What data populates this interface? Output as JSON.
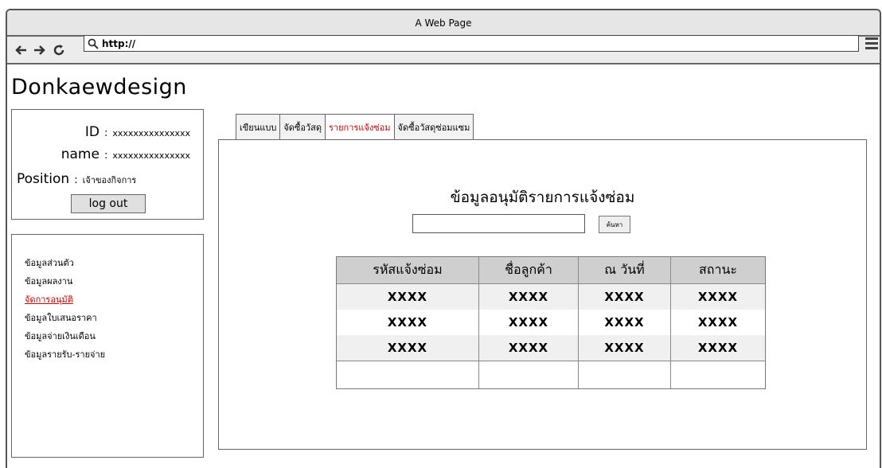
{
  "window": {
    "title": "A Web Page"
  },
  "browser": {
    "url": "http://"
  },
  "brand": "Donkaewdesign",
  "profile": {
    "id_label": "ID",
    "id_value": "xxxxxxxxxxxxxxx",
    "name_label": "name",
    "name_value": "xxxxxxxxxxxxxxx",
    "position_label": "Position",
    "position_value": "เจ้าของกิจการ",
    "separator": ":",
    "logout_label": "log out"
  },
  "sidebar": {
    "items": [
      {
        "label": "ข้อมูลส่วนตัว",
        "active": false
      },
      {
        "label": "ข้อมูลผลงาน",
        "active": false
      },
      {
        "label": "จัดการอนุมัติ",
        "active": true
      },
      {
        "label": "ข้อมูลใบเสนอราคา",
        "active": false
      },
      {
        "label": "ข้อมูลจ่ายเงินเดือน",
        "active": false
      },
      {
        "label": "ข้อมูลรายรับ-รายจ่าย",
        "active": false
      }
    ]
  },
  "tabs": [
    {
      "label": "เขียนแบบ",
      "active": false
    },
    {
      "label": "จัดซื้อวัสดุ",
      "active": false
    },
    {
      "label": "รายการแจ้งซ่อม",
      "active": true
    },
    {
      "label": "จัดซื้อวัสดุซ่อมแซม",
      "active": false
    }
  ],
  "main": {
    "title": "ข้อมูลอนุมัติรายการแจ้งซ่อม",
    "search_button": "ค้นหา",
    "search_value": "",
    "table": {
      "headers": [
        "รหัสแจ้งซ่อม",
        "ชื่อลูกค้า",
        "ณ วันที่",
        "สถานะ"
      ],
      "rows": [
        [
          "XXXX",
          "XXXX",
          "XXXX",
          "XXXX"
        ],
        [
          "XXXX",
          "XXXX",
          "XXXX",
          "XXXX"
        ],
        [
          "XXXX",
          "XXXX",
          "XXXX",
          "XXXX"
        ]
      ]
    }
  }
}
